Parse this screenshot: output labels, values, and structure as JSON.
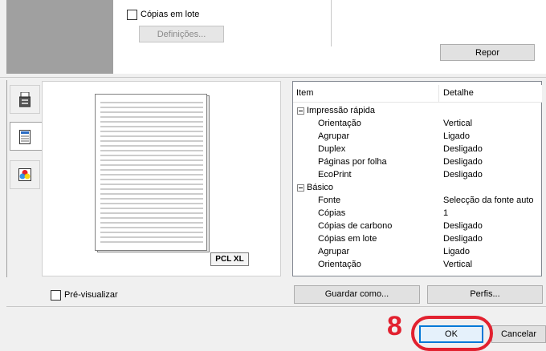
{
  "collate_checkbox": {
    "label": "Cópias em lote",
    "checked": false
  },
  "settings_button": "Definições...",
  "reset_button": "Repor",
  "tabs": [
    {
      "icon": "printer-icon"
    },
    {
      "icon": "document-icon"
    },
    {
      "icon": "color-icon"
    }
  ],
  "preview": {
    "badge": "PCL XL"
  },
  "list": {
    "col_item": "Item",
    "col_detail": "Detalhe",
    "groups": [
      {
        "name": "Impressão rápida",
        "rows": [
          {
            "item": "Orientação",
            "detail": "Vertical"
          },
          {
            "item": "Agrupar",
            "detail": "Ligado"
          },
          {
            "item": "Duplex",
            "detail": "Desligado"
          },
          {
            "item": "Páginas por folha",
            "detail": "Desligado"
          },
          {
            "item": "EcoPrint",
            "detail": "Desligado"
          }
        ]
      },
      {
        "name": "Básico",
        "rows": [
          {
            "item": "Fonte",
            "detail": "Selecção da fonte auto"
          },
          {
            "item": "Cópias",
            "detail": "1"
          },
          {
            "item": "Cópias de carbono",
            "detail": "Desligado"
          },
          {
            "item": "Cópias em lote",
            "detail": "Desligado"
          },
          {
            "item": "Agrupar",
            "detail": "Ligado"
          },
          {
            "item": "Orientação",
            "detail": "Vertical"
          }
        ]
      }
    ]
  },
  "preview_checkbox": {
    "label": "Pré-visualizar",
    "checked": false
  },
  "save_as_button": "Guardar como...",
  "profiles_button": "Perfis...",
  "ok_button": "OK",
  "cancel_button": "Cancelar",
  "callout": {
    "number": "8",
    "color": "#e2212f"
  }
}
